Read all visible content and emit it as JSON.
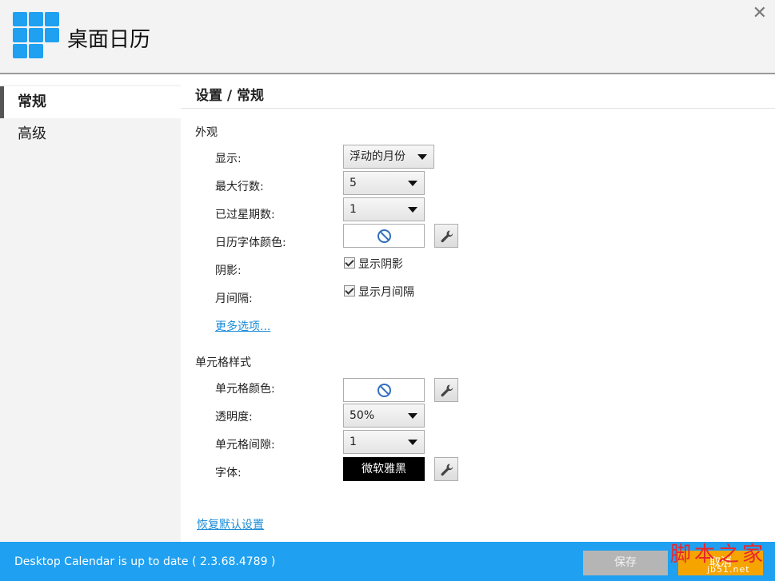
{
  "app": {
    "title": "桌面日历"
  },
  "sidebar": {
    "items": [
      {
        "label": "常规"
      },
      {
        "label": "高级"
      }
    ]
  },
  "page": {
    "heading": "设置 / 常规"
  },
  "appearance": {
    "title": "外观",
    "display": {
      "label": "显示:",
      "value": "浮动的月份"
    },
    "max_rows": {
      "label": "最大行数:",
      "value": "5"
    },
    "past_weeks": {
      "label": "已过星期数:",
      "value": "1"
    },
    "font_color": {
      "label": "日历字体颜色:"
    },
    "shadow": {
      "label": "阴影:",
      "checkbox_label": "显示阴影",
      "checked": true
    },
    "month_gap": {
      "label": "月间隔:",
      "checkbox_label": "显示月间隔",
      "checked": true
    },
    "more_options": "更多选项..."
  },
  "cell_style": {
    "title": "单元格样式",
    "cell_color": {
      "label": "单元格颜色:"
    },
    "opacity": {
      "label": "透明度:",
      "value": "50%"
    },
    "cell_gap": {
      "label": "单元格间隙:",
      "value": "1"
    },
    "font": {
      "label": "字体:",
      "value": "微软雅黑"
    }
  },
  "restore_defaults": "恢复默认设置",
  "footer": {
    "status": "Desktop Calendar is up to date ( 2.3.68.4789 )",
    "save_label": "保存",
    "cancel_label": "取消",
    "watermark": "脚本之家",
    "watermark_url": "jb51.net"
  },
  "colors": {
    "accent": "#1fa0f0",
    "link": "#1a8bd6",
    "cancel": "#f5a400",
    "save_disabled": "#b5b5b5"
  }
}
